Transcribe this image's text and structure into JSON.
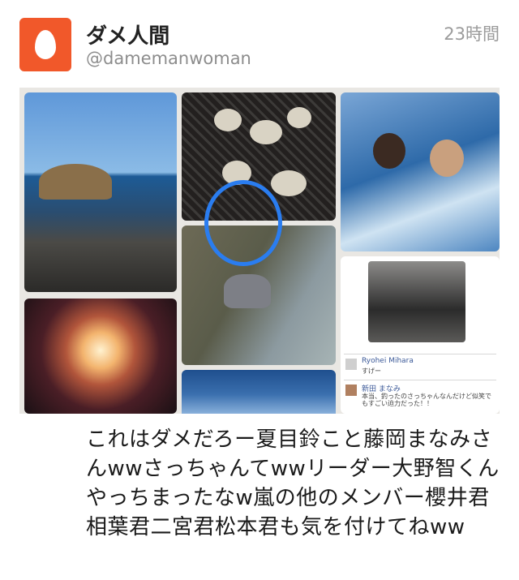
{
  "tweet": {
    "display_name": "ダメ人間",
    "handle": "@damemanwoman",
    "timestamp": "23時間",
    "text": "これはダメだろー夏目鈴こと藤岡まなみさんwwさっちゃんてwwリーダー大野智くんやっちまったなw嵐の他のメンバー櫻井君相葉君二宮君松本君も気を付けてねww"
  },
  "avatar": {
    "icon": "egg-icon",
    "color": "#f1582a"
  },
  "colors": {
    "accent": "#f1582a",
    "circle_mark": "#2a7df0"
  },
  "facebook_snippet": {
    "commenter_1_name": "Ryohei Mihara",
    "commenter_1_text": "すげー",
    "commenter_2_name": "新田 まなみ",
    "commenter_2_text": "本当、釣ったのさっちゃんなんだけど似笑でもすごい迫力だった！！"
  }
}
